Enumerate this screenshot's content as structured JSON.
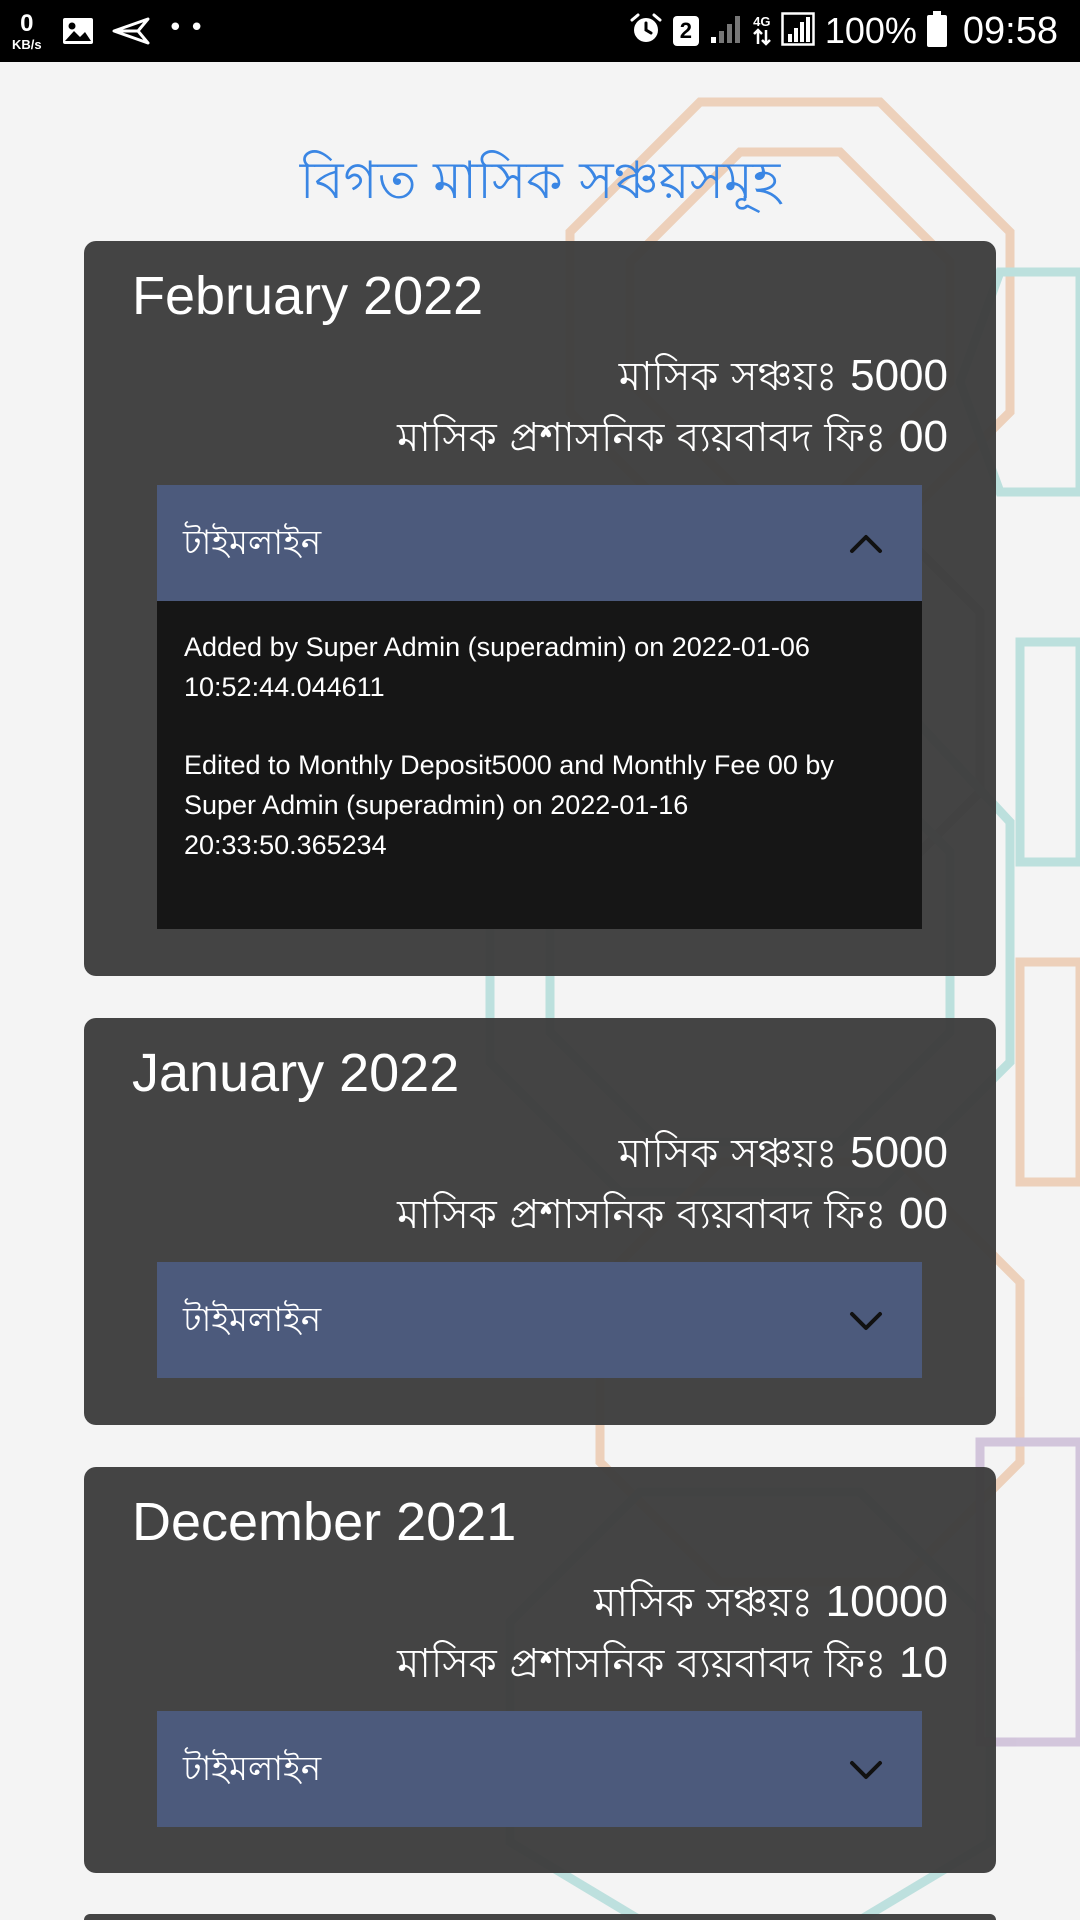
{
  "status_bar": {
    "net_speed_value": "0",
    "net_speed_unit": "KB/s",
    "dots": "••",
    "sim_number": "2",
    "network_type": "4G",
    "battery_percent": "100%",
    "time": "09:58",
    "icons": [
      "gallery-icon",
      "send-icon",
      "alarm-icon",
      "signal-icon",
      "data-arrows-icon",
      "signal-full-icon",
      "battery-icon"
    ]
  },
  "page": {
    "title": "বিগত মাসিক সঞ্চয়সমূহ"
  },
  "cards": [
    {
      "month": "February 2022",
      "deposit_label": "মাসিক সঞ্চয়ঃ",
      "deposit_value": "5000",
      "fee_label": "মাসিক প্রশাসনিক ব্যয়বাবদ ফিঃ",
      "fee_value": "00",
      "timeline_label": "টাইমলাইন",
      "timeline_expanded": true,
      "timeline_entries": [
        "Added by Super Admin (superadmin) on 2022-01-06 10:52:44.044611",
        "Edited to Monthly Deposit5000 and Monthly Fee 00 by Super Admin (superadmin) on 2022-01-16 20:33:50.365234"
      ]
    },
    {
      "month": "January 2022",
      "deposit_label": "মাসিক সঞ্চয়ঃ",
      "deposit_value": "5000",
      "fee_label": "মাসিক প্রশাসনিক ব্যয়বাবদ ফিঃ",
      "fee_value": "00",
      "timeline_label": "টাইমলাইন",
      "timeline_expanded": false
    },
    {
      "month": "December 2021",
      "deposit_label": "মাসিক সঞ্চয়ঃ",
      "deposit_value": "10000",
      "fee_label": "মাসিক প্রশাসনিক ব্যয়বাবদ ফিঃ",
      "fee_value": "10",
      "timeline_label": "টাইমলাইন",
      "timeline_expanded": false
    }
  ],
  "colors": {
    "title": "#3a86e4",
    "card_bg": "#3e3e3e",
    "timeline_header_bg": "#4c5a7c",
    "timeline_body_bg": "#161616"
  }
}
